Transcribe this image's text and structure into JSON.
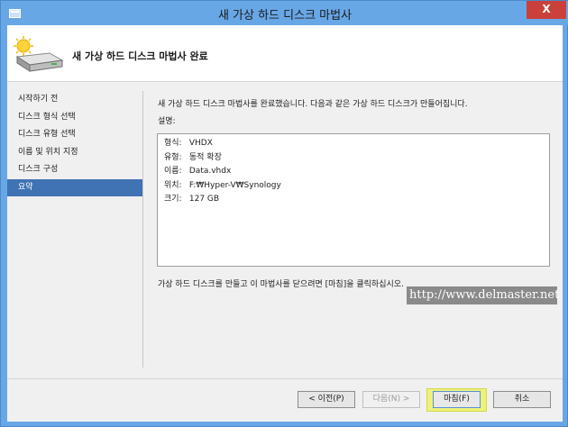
{
  "window": {
    "title": "새 가상 하드 디스크 마법사",
    "close_label": "X"
  },
  "header": {
    "title": "새 가상 하드 디스크 마법사 완료",
    "icon": "hard-disk-wizard-icon"
  },
  "nav": {
    "items": [
      {
        "label": "시작하기 전",
        "active": false
      },
      {
        "label": "디스크 형식 선택",
        "active": false
      },
      {
        "label": "디스크 유형 선택",
        "active": false
      },
      {
        "label": "이름 및 위치 지정",
        "active": false
      },
      {
        "label": "디스크 구성",
        "active": false
      },
      {
        "label": "요약",
        "active": true
      }
    ]
  },
  "main": {
    "intro": "새 가상 하드 디스크 마법사를 완료했습니다. 다음과 같은 가상 하드 디스크가 만들어집니다.",
    "description_label": "설명:",
    "summary": [
      {
        "key": "형식:",
        "value": "VHDX"
      },
      {
        "key": "유형:",
        "value": "동적 확장"
      },
      {
        "key": "이름:",
        "value": "Data.vhdx"
      },
      {
        "key": "위치:",
        "value": "F:₩Hyper-V₩Synology"
      },
      {
        "key": "크기:",
        "value": "127 GB"
      }
    ],
    "footer_note": "가상 하드 디스크를 만들고 이 마법사를 닫으려면 [마침]을 클릭하십시오."
  },
  "watermark": "http://www.delmaster.net",
  "buttons": {
    "prev": "< 이전(P)",
    "next": "다음(N) >",
    "finish": "마침(F)",
    "cancel": "취소"
  }
}
